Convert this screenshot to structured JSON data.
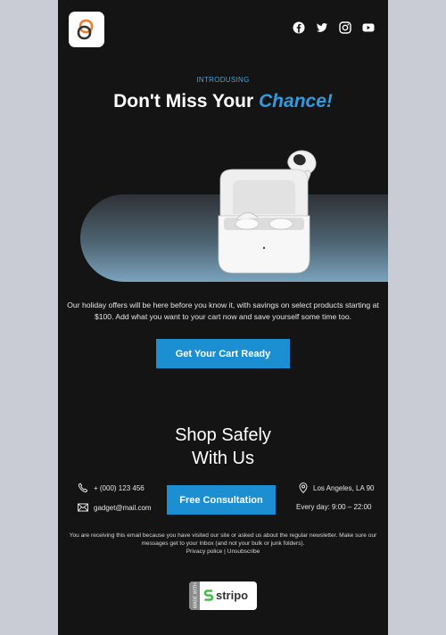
{
  "social": {
    "icons": [
      "facebook-icon",
      "twitter-icon",
      "instagram-icon",
      "youtube-icon"
    ]
  },
  "hero": {
    "eyebrow": "INTRODUSING",
    "headline_start": "Don't Miss Your ",
    "headline_accent": "Chance!",
    "accent_color": "#2f9be0"
  },
  "body": {
    "text": "Our holiday offers will be here before you know it, with savings on select products starting at $100. Add what you want to your cart now and save yourself some time too."
  },
  "cta": {
    "label": "Get Your Cart Ready",
    "color": "#1b8fd2"
  },
  "section": {
    "title_line1": "Shop Safely",
    "title_line2": "With Us"
  },
  "contact": {
    "phone": "+ (000) 123 456",
    "email": "gadget@mail.com",
    "location": "Los Angeles, LA 90",
    "hours": "Every day: 9:00 – 22:00",
    "button_label": "Free Consultation"
  },
  "footer": {
    "note": "You are receiving this email because you have visited our site or asked us about the regular newsletter. Make sure our messages get to your Inbox (and not your bulk or junk folders).",
    "privacy": "Privacy police",
    "separator": " | ",
    "unsubscribe": "Unsubscribe"
  },
  "badge": {
    "side_text": "MADE WITH",
    "brand": "stripo"
  }
}
